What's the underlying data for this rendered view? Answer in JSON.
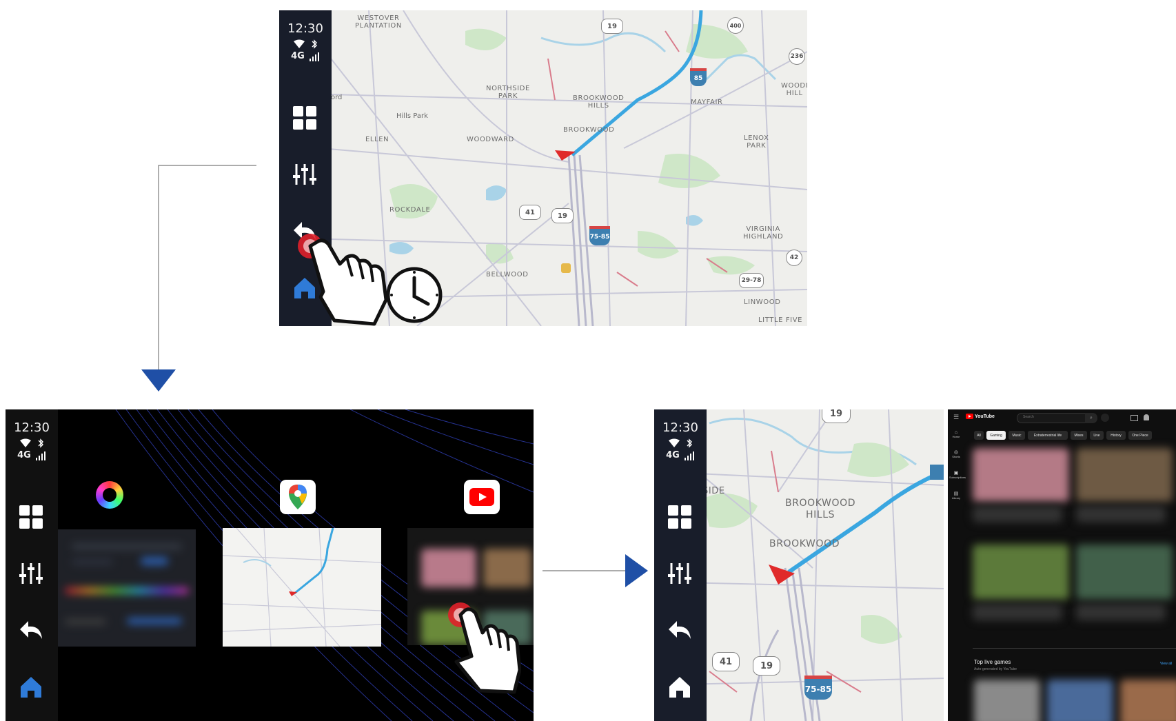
{
  "status_bar": {
    "time": "12:30",
    "network": "4G"
  },
  "nav_icons": [
    "grid-icon",
    "equalizer-icon",
    "back-icon",
    "home-icon"
  ],
  "map": {
    "labels": [
      "WESTOVER\nPLANTATION",
      "NORTHSIDE\nPARK",
      "BROOKWOOD\nHILLS",
      "BROOKWOOD",
      "MAYFAIR",
      "Hills Park",
      "ELLEN",
      "WOODWARD",
      "LENOX\nPARK",
      "ROCKDALE",
      "VIRGINIA\nHIGHLAND",
      "BELLWOOD",
      "LINWOOD",
      "LITTLE FIVE",
      "WOODI\nHILL",
      "ord"
    ],
    "shields": [
      "19",
      "236",
      "85",
      "41",
      "19",
      "75-85",
      "42",
      "29-78",
      "400"
    ]
  },
  "step3_map": {
    "labels": [
      "SIDE",
      "BROOKWOOD\nHILLS",
      "BROOKWOOD"
    ],
    "shields": [
      "19",
      "41",
      "19",
      "75-85"
    ]
  },
  "home_screen": {
    "apps": [
      "color-wheel-icon",
      "google-maps-icon",
      "youtube-icon"
    ]
  },
  "youtube": {
    "brand": "YouTube",
    "search_placeholder": "Search",
    "chips": [
      "All",
      "Gaming",
      "Music",
      "Extraterrestrial life",
      "Mixes",
      "Live",
      "History",
      "One Piece"
    ],
    "sidebar": [
      "Home",
      "Shorts",
      "Subscriptions",
      "Library"
    ],
    "section_title": "Top live games",
    "section_subtitle": "Auto-generated by YouTube",
    "view_all": "View all"
  },
  "colors": {
    "sidebar": "#181d2a",
    "route": "#3aa6e0",
    "arrows": "#1f4fa6",
    "tap_ring": "#e0202a"
  }
}
